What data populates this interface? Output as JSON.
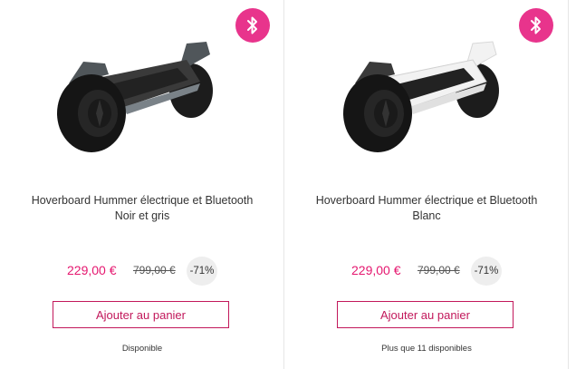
{
  "colors": {
    "accent": "#e5176f",
    "badge": "#e8348c",
    "button_border": "#c2185b"
  },
  "products": [
    {
      "badge_icon": "bluetooth-icon",
      "title_line1": "Hoverboard Hummer électrique et Bluetooth",
      "title_line2": "Noir et gris",
      "price": "229,00 €",
      "old_price": "799,00 €",
      "discount": "-71%",
      "button_label": "Ajouter au panier",
      "stock": "Disponible",
      "body_color": "#3a3a3a"
    },
    {
      "badge_icon": "bluetooth-icon",
      "title_line1": "Hoverboard Hummer électrique et Bluetooth",
      "title_line2": "Blanc",
      "price": "229,00 €",
      "old_price": "799,00 €",
      "discount": "-71%",
      "button_label": "Ajouter au panier",
      "stock": "Plus que 11 disponibles",
      "body_color": "#f2f2f2"
    }
  ]
}
